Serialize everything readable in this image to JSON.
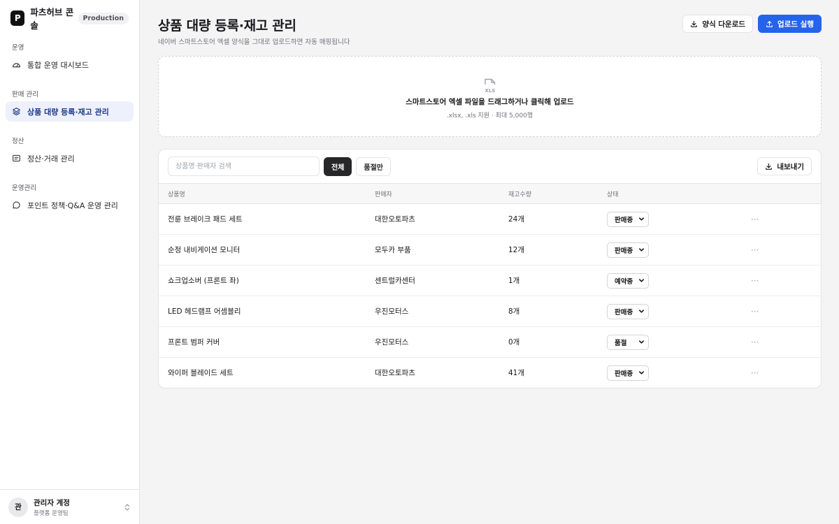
{
  "brand": {
    "logo_letter": "P",
    "name": "파츠허브 콘솔",
    "env": "Production"
  },
  "sidebar": {
    "sections": [
      {
        "title": "운영",
        "item": {
          "label": "통합 운영 대시보드",
          "icon": "dashboard-gauge-icon"
        }
      },
      {
        "title": "판매 관리",
        "item": {
          "label": "상품 대량 등록·재고 관리",
          "icon": "layers-icon",
          "active": true
        }
      },
      {
        "title": "정산",
        "item": {
          "label": "정산·거래 관리",
          "icon": "receipt-icon"
        }
      },
      {
        "title": "운영관리",
        "item": {
          "label": "포인트 정책·Q&A 운영 관리",
          "icon": "chat-bubble-icon"
        }
      }
    ]
  },
  "account": {
    "avatar": "관",
    "name": "관리자 계정",
    "team": "플랫폼 운영팀"
  },
  "header": {
    "title": "상품 대량 등록·재고 관리",
    "subtitle": "네이버 스마트스토어 엑셀 양식을 그대로 업로드하면 자동 매핑됩니다",
    "template_download_label": "양식 다운로드",
    "upload_run_label": "업로드 실행"
  },
  "dropzone": {
    "icon_text": "XLS",
    "title": "스마트스토어 엑셀 파일을 드래그하거나 클릭해 업로드",
    "hint": ".xlsx, .xls 지원 · 최대 5,000행"
  },
  "toolbar": {
    "search_placeholder": "상품명·판매자 검색",
    "filter_all": "전체",
    "filter_soldout": "품절만",
    "export_label": "내보내기"
  },
  "table": {
    "columns": [
      "상품명",
      "판매자",
      "재고수량",
      "상태"
    ],
    "rows": [
      {
        "name": "전륜 브레이크 패드 세트",
        "seller": "대한오토파츠",
        "stock": "24개",
        "status": "판매중"
      },
      {
        "name": "순정 내비게이션 모니터",
        "seller": "모두카 부품",
        "stock": "12개",
        "status": "판매중"
      },
      {
        "name": "쇼크업소버 (프론트 좌)",
        "seller": "센트럴카센터",
        "stock": "1개",
        "status": "예약중"
      },
      {
        "name": "LED 헤드램프 어셈블리",
        "seller": "우진모터스",
        "stock": "8개",
        "status": "판매중"
      },
      {
        "name": "프론트 범퍼 커버",
        "seller": "우진모터스",
        "stock": "0개",
        "status": "품절"
      },
      {
        "name": "와이퍼 블레이드 세트",
        "seller": "대한오토파츠",
        "stock": "41개",
        "status": "판매중"
      }
    ],
    "more_glyph": "···"
  },
  "colors": {
    "primary": "#2563eb",
    "active_nav_bg": "#eef1fb",
    "active_nav_text": "#1e3a8a"
  }
}
